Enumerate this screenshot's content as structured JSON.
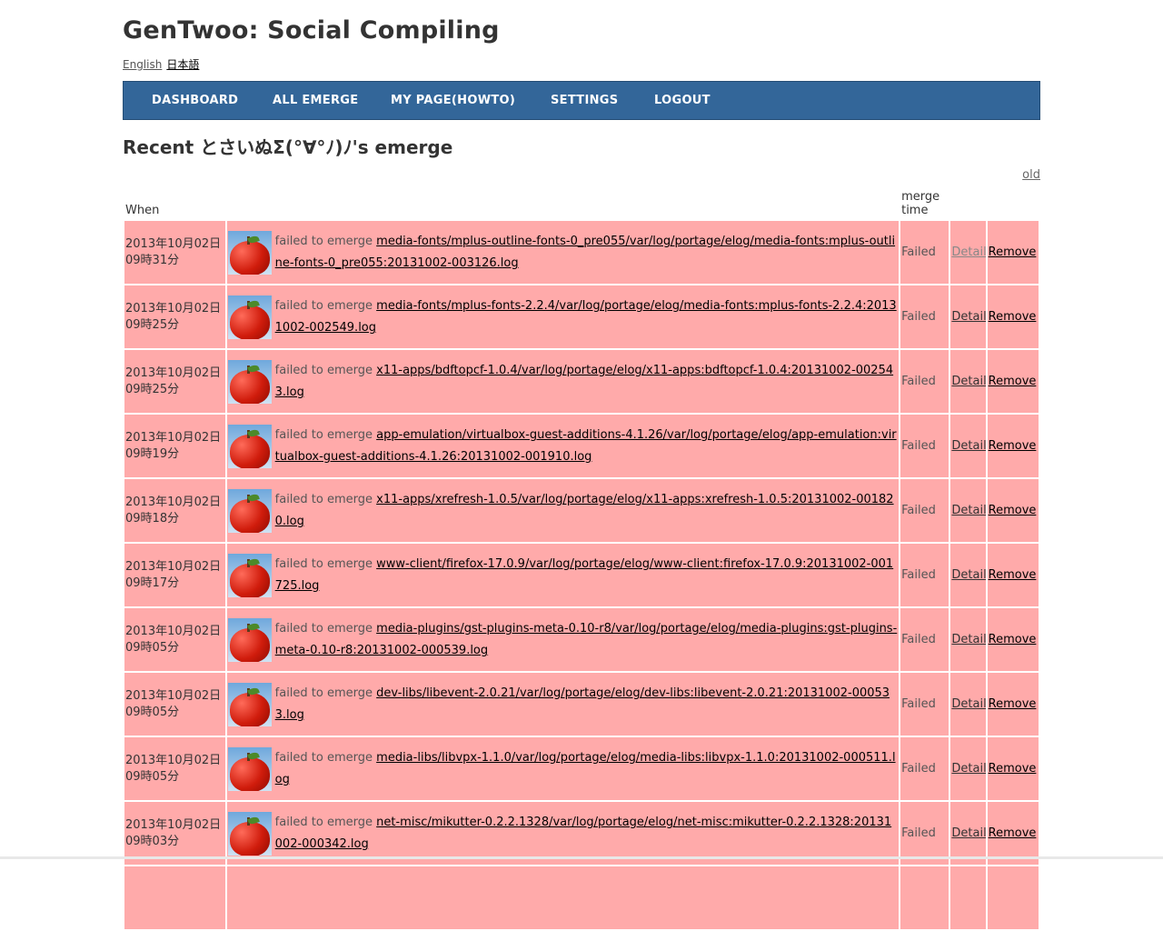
{
  "site": {
    "title": "GenTwoo: Social Compiling",
    "languages": [
      {
        "label": "English",
        "current": false
      },
      {
        "label": "日本語",
        "current": true
      }
    ]
  },
  "nav": {
    "items": [
      {
        "label": "DASHBOARD"
      },
      {
        "label": "ALL EMERGE"
      },
      {
        "label": "MY PAGE(HOWTO)"
      },
      {
        "label": "SETTINGS"
      },
      {
        "label": "LOGOUT"
      }
    ]
  },
  "page": {
    "heading": "Recent とさいぬΣ(°∀°ﾉ)ﾉ's emerge",
    "old_link": "old"
  },
  "table": {
    "headers": {
      "when": "When",
      "what": "",
      "merge_time": "merge time",
      "detail": "",
      "remove": ""
    },
    "rows": [
      {
        "date": "2013年10月02日",
        "time": "09時31分",
        "status_text": "failed to emerge",
        "package": "media-fonts/mplus-outline-fonts-0_pre055/var/log/portage/elog/media-fonts:mplus-outline-fonts-0_pre055:20131002-003126.log",
        "result": "Failed",
        "detail": "Detail",
        "remove": "Remove"
      },
      {
        "date": "2013年10月02日",
        "time": "09時25分",
        "status_text": "failed to emerge",
        "package": "media-fonts/mplus-fonts-2.2.4/var/log/portage/elog/media-fonts:mplus-fonts-2.2.4:20131002-002549.log",
        "result": "Failed",
        "detail": "Detail",
        "remove": "Remove"
      },
      {
        "date": "2013年10月02日",
        "time": "09時25分",
        "status_text": "failed to emerge",
        "package": "x11-apps/bdftopcf-1.0.4/var/log/portage/elog/x11-apps:bdftopcf-1.0.4:20131002-002543.log",
        "result": "Failed",
        "detail": "Detail",
        "remove": "Remove"
      },
      {
        "date": "2013年10月02日",
        "time": "09時19分",
        "status_text": "failed to emerge",
        "package": "app-emulation/virtualbox-guest-additions-4.1.26/var/log/portage/elog/app-emulation:virtualbox-guest-additions-4.1.26:20131002-001910.log",
        "result": "Failed",
        "detail": "Detail",
        "remove": "Remove"
      },
      {
        "date": "2013年10月02日",
        "time": "09時18分",
        "status_text": "failed to emerge",
        "package": "x11-apps/xrefresh-1.0.5/var/log/portage/elog/x11-apps:xrefresh-1.0.5:20131002-001820.log",
        "result": "Failed",
        "detail": "Detail",
        "remove": "Remove"
      },
      {
        "date": "2013年10月02日",
        "time": "09時17分",
        "status_text": "failed to emerge",
        "package": "www-client/firefox-17.0.9/var/log/portage/elog/www-client:firefox-17.0.9:20131002-001725.log",
        "result": "Failed",
        "detail": "Detail",
        "remove": "Remove"
      },
      {
        "date": "2013年10月02日",
        "time": "09時05分",
        "status_text": "failed to emerge",
        "package": "media-plugins/gst-plugins-meta-0.10-r8/var/log/portage/elog/media-plugins:gst-plugins-meta-0.10-r8:20131002-000539.log",
        "result": "Failed",
        "detail": "Detail",
        "remove": "Remove"
      },
      {
        "date": "2013年10月02日",
        "time": "09時05分",
        "status_text": "failed to emerge",
        "package": "dev-libs/libevent-2.0.21/var/log/portage/elog/dev-libs:libevent-2.0.21:20131002-000533.log",
        "result": "Failed",
        "detail": "Detail",
        "remove": "Remove"
      },
      {
        "date": "2013年10月02日",
        "time": "09時05分",
        "status_text": "failed to emerge",
        "package": "media-libs/libvpx-1.1.0/var/log/portage/elog/media-libs:libvpx-1.1.0:20131002-000511.log",
        "result": "Failed",
        "detail": "Detail",
        "remove": "Remove"
      },
      {
        "date": "2013年10月02日",
        "time": "09時03分",
        "status_text": "failed to emerge",
        "package": "net-misc/mikutter-0.2.2.1328/var/log/portage/elog/net-misc:mikutter-0.2.2.1328:20131002-000342.log",
        "result": "Failed",
        "detail": "Detail",
        "remove": "Remove"
      },
      {
        "date": "",
        "time": "",
        "status_text": "",
        "package": "",
        "result": "",
        "detail": "",
        "remove": ""
      }
    ]
  },
  "colors": {
    "nav_bg": "#336699",
    "row_failed_bg": "#ffaaaa",
    "text": "#333333"
  },
  "icons": {
    "avatar": "tomato-avatar-icon"
  }
}
